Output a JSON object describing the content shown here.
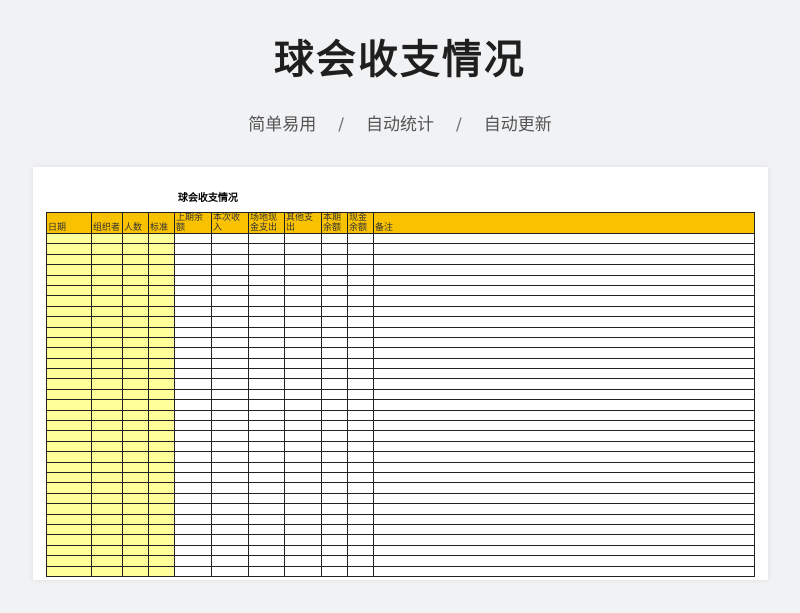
{
  "page": {
    "title": "球会收支情况",
    "subtitle": [
      "简单易用",
      "自动统计",
      "自动更新"
    ],
    "separator": "/"
  },
  "sheet": {
    "title": "球会收支情况",
    "columns": [
      "日期",
      "组织者",
      "人数",
      "标准",
      "上期余额",
      "本次收入",
      "场地现金支出",
      "其他支出",
      "本期余额",
      "现金余额",
      "备注"
    ],
    "row_count": 33
  },
  "colors": {
    "header_bg": "#f9c200",
    "input_cell_bg": "#ffff99",
    "page_bg": "#f1f2f4"
  }
}
